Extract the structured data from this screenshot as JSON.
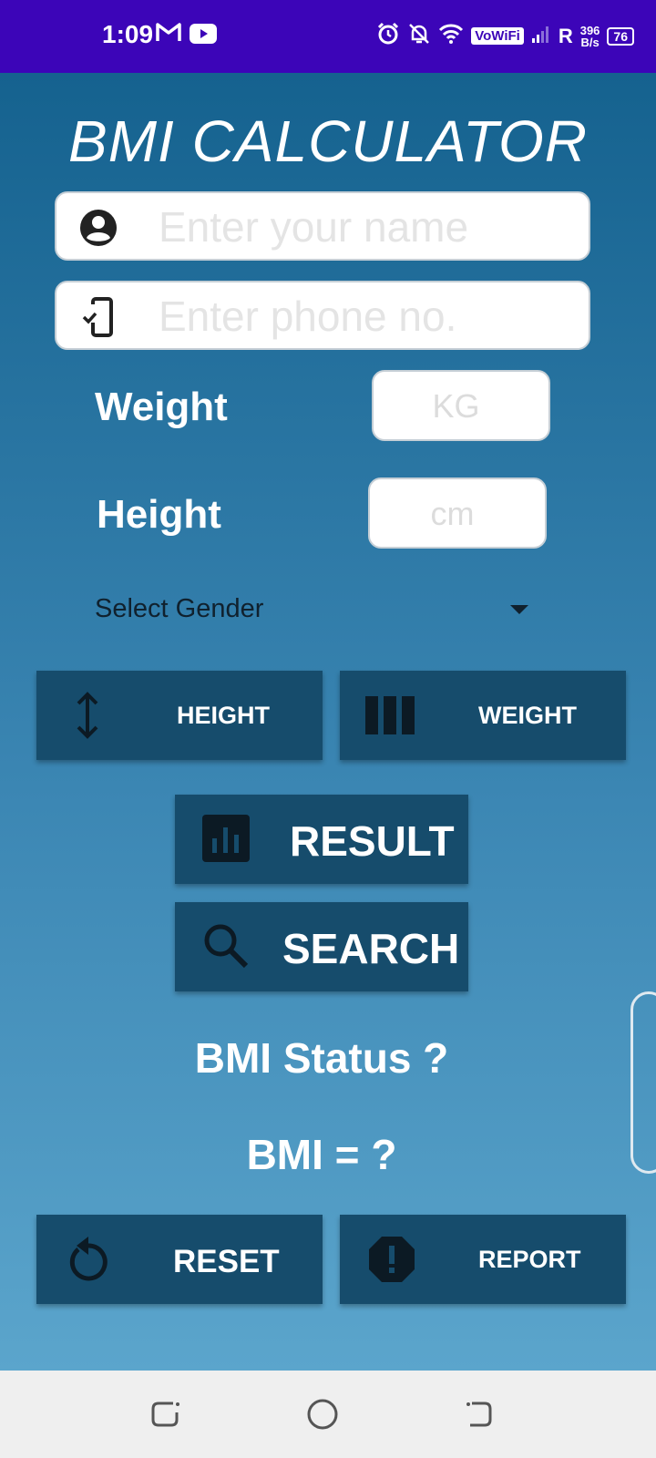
{
  "status_bar": {
    "time": "1:09",
    "vowifi": "VoWiFi",
    "roaming": "R",
    "net_speed_value": "396",
    "net_speed_unit": "B/s",
    "battery": "76"
  },
  "app": {
    "title": "BMI CALCULATOR",
    "name_field": {
      "placeholder": "Enter your name",
      "value": ""
    },
    "phone_field": {
      "placeholder": "Enter phone no.",
      "value": ""
    },
    "weight_label": "Weight",
    "weight_field": {
      "placeholder": "KG",
      "value": ""
    },
    "height_label": "Height",
    "height_field": {
      "placeholder": "cm",
      "value": ""
    },
    "gender_select": {
      "selected": "Select Gender"
    },
    "buttons": {
      "height": "HEIGHT",
      "weight": "WEIGHT",
      "result": "RESULT",
      "search": "SEARCH",
      "reset": "RESET",
      "report": "REPORT"
    },
    "bmi_status": "BMI Status ?",
    "bmi_value": "BMI = ?"
  },
  "colors": {
    "status_bar": "#3c05b8",
    "button_bg": "#164c6c",
    "gradient_top": "#15628f",
    "gradient_bottom": "#5ba5cc"
  }
}
